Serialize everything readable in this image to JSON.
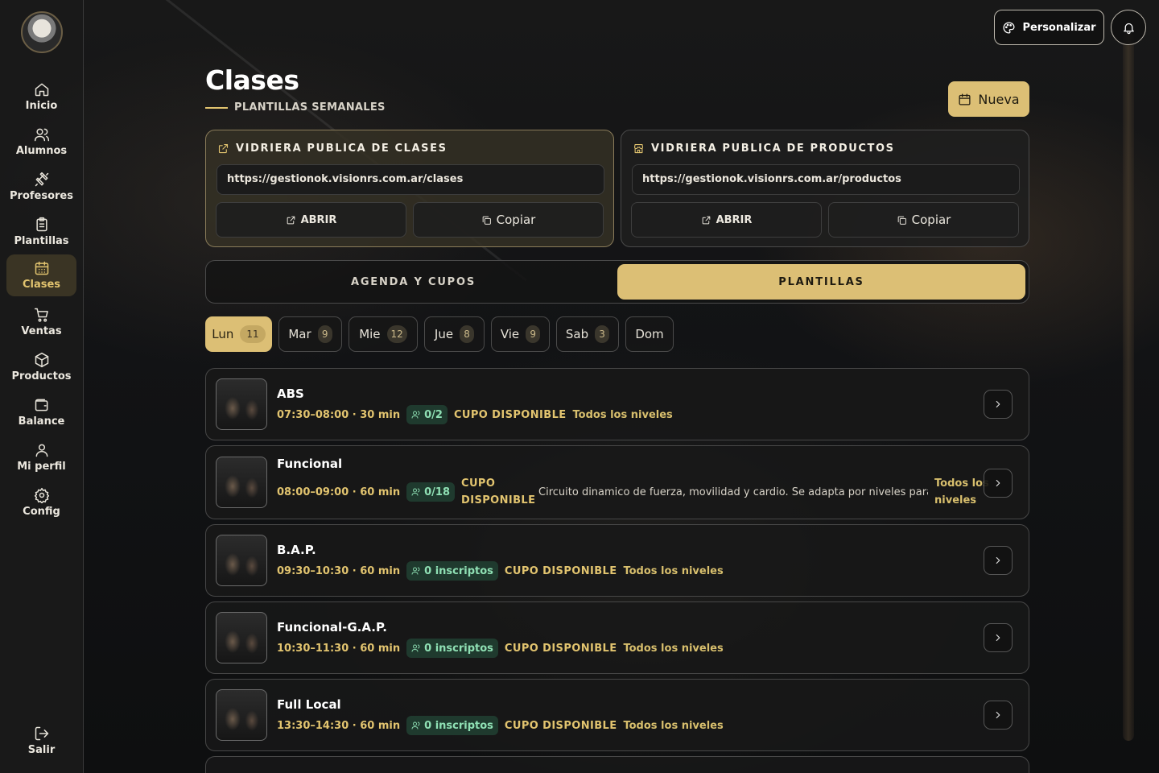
{
  "nav": {
    "items": [
      {
        "label": "Inicio",
        "icon": "home-icon"
      },
      {
        "label": "Alumnos",
        "icon": "users-icon"
      },
      {
        "label": "Profesores",
        "icon": "dumbbell-icon"
      },
      {
        "label": "Plantillas",
        "icon": "clipboard-icon"
      },
      {
        "label": "Clases",
        "icon": "calendar-icon",
        "active": true
      },
      {
        "label": "Ventas",
        "icon": "cart-icon"
      },
      {
        "label": "Productos",
        "icon": "box-icon"
      },
      {
        "label": "Balance",
        "icon": "wallet-icon"
      },
      {
        "label": "Mi perfil",
        "icon": "user-icon"
      },
      {
        "label": "Config",
        "icon": "gear-icon"
      }
    ],
    "logout_label": "Salir"
  },
  "topbar": {
    "customize_label": "Personalizar"
  },
  "header": {
    "title": "Clases",
    "subtitle": "PLANTILLAS SEMANALES",
    "new_label": "Nueva"
  },
  "vidrieras": [
    {
      "title": "VIDRIERA PUBLICA DE CLASES",
      "url": "https://gestionok.visionrs.com.ar/clases",
      "open_label": "ABRIR",
      "copy_label": "Copiar"
    },
    {
      "title": "VIDRIERA PUBLICA DE PRODUCTOS",
      "url": "https://gestionok.visionrs.com.ar/productos",
      "open_label": "ABRIR",
      "copy_label": "Copiar"
    }
  ],
  "tabs": {
    "agenda": "AGENDA Y CUPOS",
    "plantillas": "PLANTILLAS",
    "active": "plantillas"
  },
  "days": [
    {
      "label": "Lun",
      "count": "11",
      "active": true
    },
    {
      "label": "Mar",
      "count": "9"
    },
    {
      "label": "Mie",
      "count": "12"
    },
    {
      "label": "Jue",
      "count": "8"
    },
    {
      "label": "Vie",
      "count": "9"
    },
    {
      "label": "Sab",
      "count": "3"
    },
    {
      "label": "Dom",
      "count": ""
    }
  ],
  "classes": [
    {
      "name": "ABS",
      "time": "07:30–08:00 · 30 min",
      "chip": "0/2",
      "cupo": "CUPO DISPONIBLE",
      "nivel": "Todos los niveles",
      "description": ""
    },
    {
      "name": "Funcional",
      "time": "08:00–09:00 · 60 min",
      "chip": "0/18",
      "cupo": "CUPO DISPONIBLE",
      "nivel": "Todos los niveles",
      "description": "Circuito dinamico de fuerza, movilidad y cardio. Se adapta por niveles para q..."
    },
    {
      "name": "B.A.P.",
      "time": "09:30–10:30 · 60 min",
      "chip": "0 inscriptos",
      "cupo": "CUPO DISPONIBLE",
      "nivel": "Todos los niveles",
      "description": ""
    },
    {
      "name": "Funcional-G.A.P.",
      "time": "10:30–11:30 · 60 min",
      "chip": "0 inscriptos",
      "cupo": "CUPO DISPONIBLE",
      "nivel": "Todos los niveles",
      "description": ""
    },
    {
      "name": "Full Local",
      "time": "13:30–14:30 · 60 min",
      "chip": "0 inscriptos",
      "cupo": "CUPO DISPONIBLE",
      "nivel": "Todos los niveles",
      "description": ""
    }
  ]
}
